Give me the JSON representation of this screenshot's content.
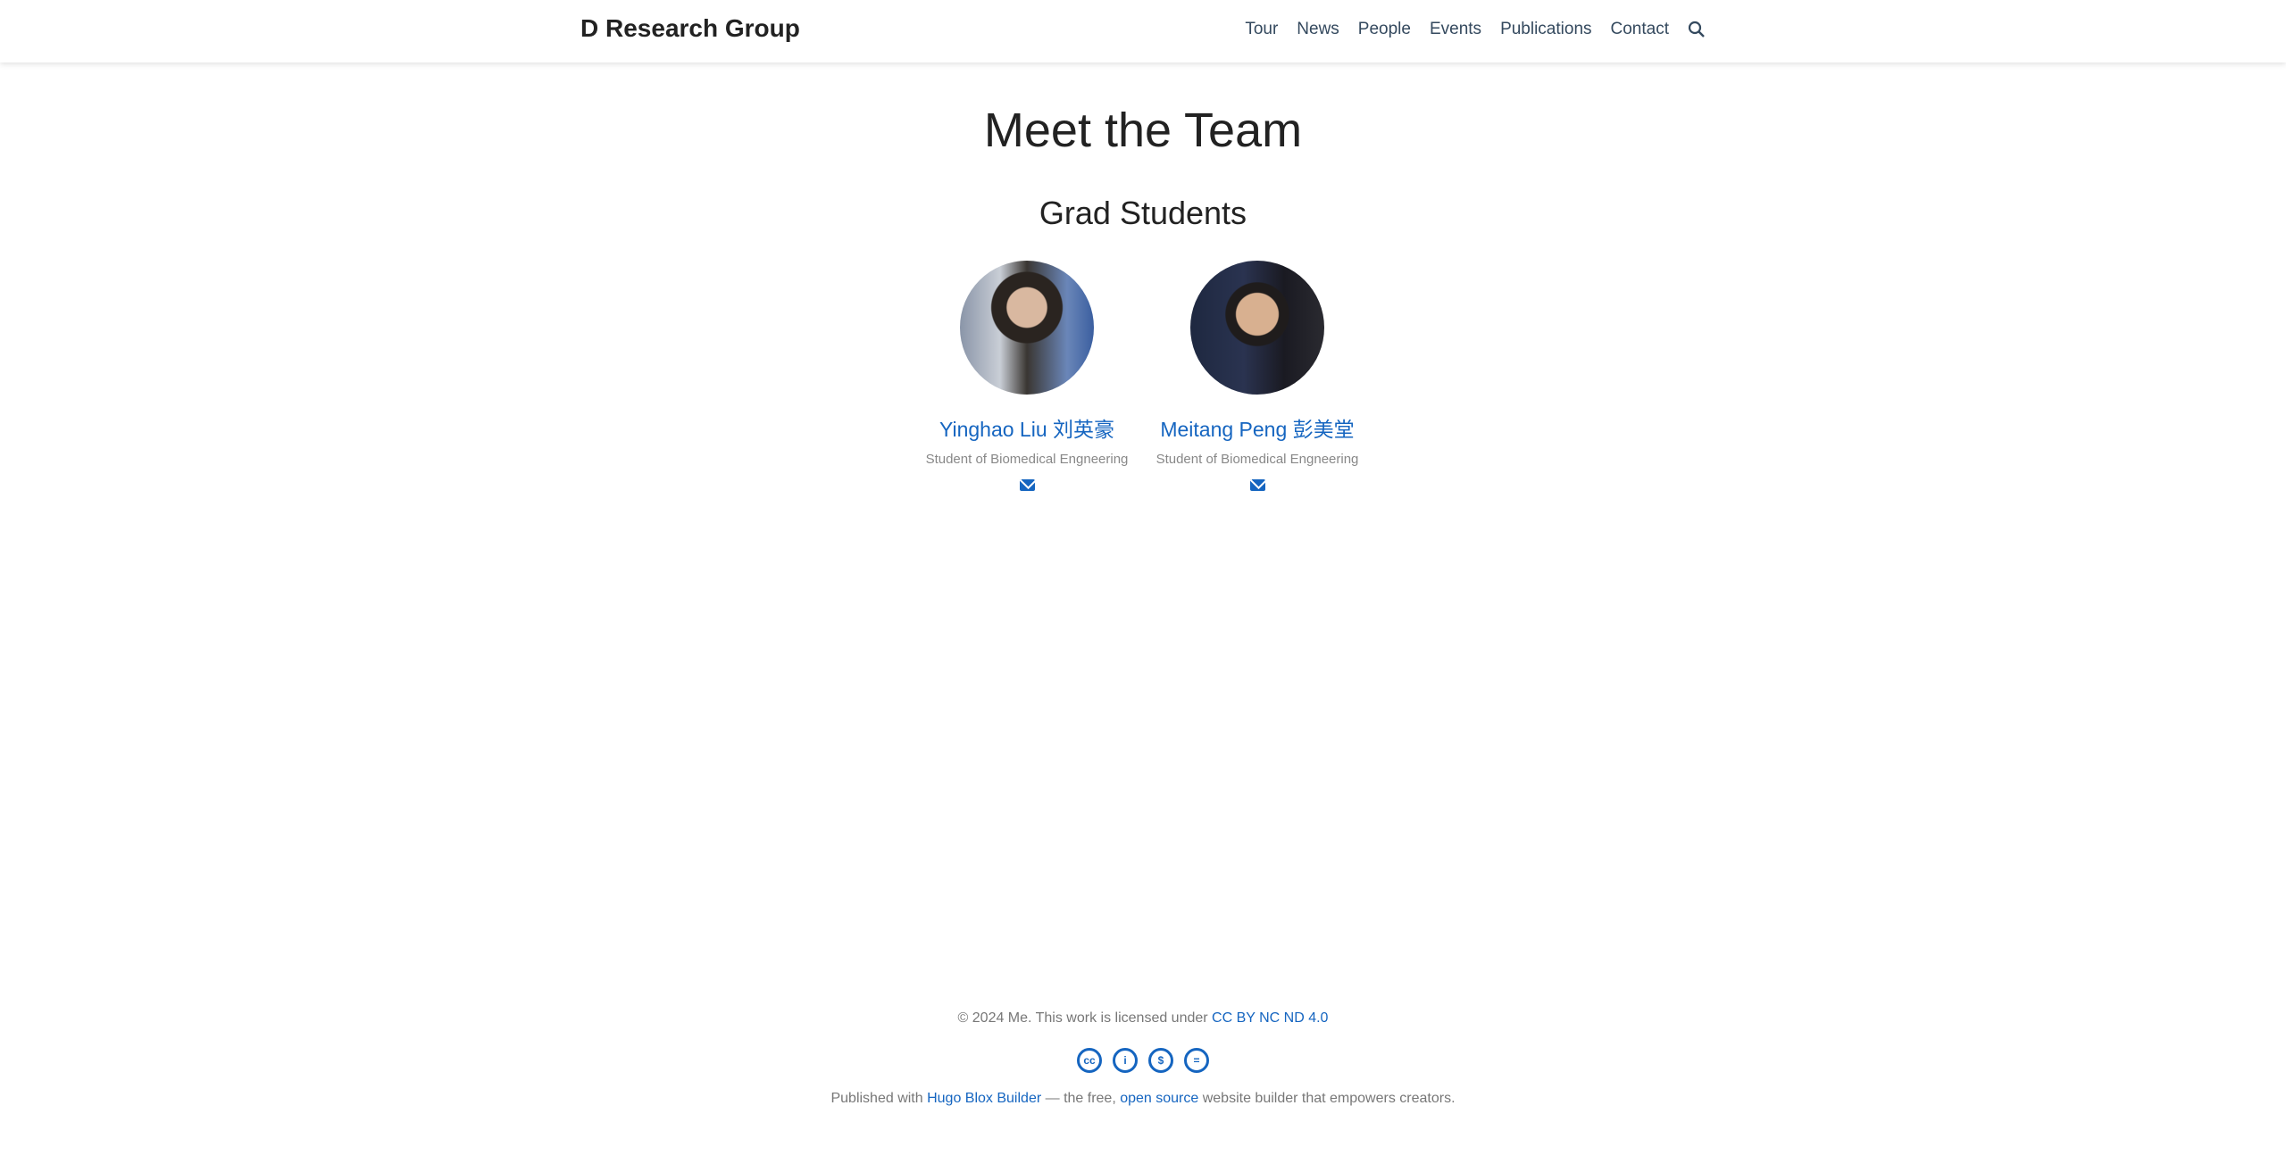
{
  "header": {
    "brand": "D Research Group",
    "nav": [
      "Tour",
      "News",
      "People",
      "Events",
      "Publications",
      "Contact"
    ],
    "search_icon": "search-icon"
  },
  "main": {
    "title": "Meet the Team",
    "section": "Grad Students",
    "people": [
      {
        "name": "Yinghao Liu 刘英豪",
        "role": "Student of Biomedical Engneering",
        "icon": "envelope-icon"
      },
      {
        "name": "Meitang Peng 彭美堂",
        "role": "Student of Biomedical Engneering",
        "icon": "envelope-icon"
      }
    ]
  },
  "footer": {
    "copyright": "© 2024 Me. This work is licensed under ",
    "license_link": "CC BY NC ND 4.0",
    "license_icons": [
      "cc-icon",
      "by-icon",
      "nc-icon",
      "nd-icon"
    ],
    "published_prefix": "Published with ",
    "hugo_link": "Hugo Blox Builder",
    "middle": " — the free, ",
    "open_source_link": "open source",
    "suffix": " website builder that empowers creators."
  },
  "colors": {
    "accent": "#1565c0",
    "text": "#222222"
  }
}
